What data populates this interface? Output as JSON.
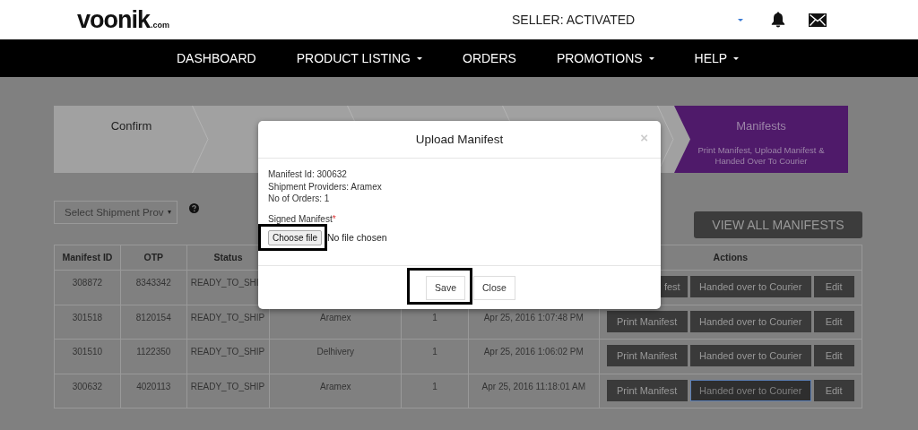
{
  "header": {
    "logo": "voonik",
    "logo_suffix": ".com",
    "seller_status": "SELLER: ACTIVATED"
  },
  "nav": [
    {
      "label": "DASHBOARD",
      "dropdown": false
    },
    {
      "label": "PRODUCT LISTING",
      "dropdown": true
    },
    {
      "label": "ORDERS",
      "dropdown": false
    },
    {
      "label": "PROMOTIONS",
      "dropdown": true
    },
    {
      "label": "HELP",
      "dropdown": true
    }
  ],
  "steps": [
    {
      "label": "Confirm",
      "selected": false
    },
    {
      "selected": false
    },
    {
      "selected": false
    },
    {
      "selected": false
    },
    {
      "label": "Manifests",
      "subtitle": "Print Manifest, Upload Manifest & Handed Over To Courier",
      "selected": true
    }
  ],
  "filter": {
    "placeholder": "Select Shipment Prov"
  },
  "view_all_button": "VIEW ALL MANIFESTS",
  "table": {
    "columns": [
      {
        "label": "Manifest ID"
      },
      {
        "label": "OTP"
      },
      {
        "label": "Status"
      },
      {},
      {},
      {},
      {
        "label": "Actions"
      }
    ],
    "rows": [
      {
        "id": "308872",
        "otp": "8343342",
        "status": "READY_TO_SHI",
        "actions": [
          {
            "label": "fest",
            "focused": false
          },
          {
            "label": "Handed over to Courier",
            "focused": false
          },
          {
            "label": "Edit",
            "focused": false
          }
        ]
      },
      {
        "id": "301518",
        "otp": "8120154",
        "status": "READY_TO_SHIP",
        "provider": "Aramex",
        "orders": "1",
        "date": "Apr 25, 2016 1:07:48 PM",
        "actions": [
          {
            "label": "Print Manifest",
            "focused": false
          },
          {
            "label": "Handed over to Courier",
            "focused": false
          },
          {
            "label": "Edit",
            "focused": false
          }
        ]
      },
      {
        "id": "301510",
        "otp": "1122350",
        "status": "READY_TO_SHIP",
        "provider": "Delhivery",
        "orders": "1",
        "date": "Apr 25, 2016 1:06:02 PM",
        "actions": [
          {
            "label": "Print Manifest",
            "focused": false
          },
          {
            "label": "Handed over to Courier",
            "focused": false
          },
          {
            "label": "Edit",
            "focused": false
          }
        ]
      },
      {
        "id": "300632",
        "otp": "4020113",
        "status": "READY_TO_SHIP",
        "provider": "Aramex",
        "orders": "1",
        "date": "Apr 25, 2016 11:18:01 AM",
        "actions": [
          {
            "label": "Print Manifest",
            "focused": false
          },
          {
            "label": "Handed over to Courier",
            "focused": true
          },
          {
            "label": "Edit",
            "focused": false
          }
        ]
      }
    ]
  },
  "modal": {
    "title": "Upload Manifest",
    "close": "×",
    "details": [
      "Manifest Id: 300632",
      "Shipment Providers: Aramex",
      "No of Orders: 1"
    ],
    "file_label": "Signed Manifest",
    "required_mark": "*",
    "choose_button": "Choose file",
    "file_status": "No file chosen",
    "save_button": "Save",
    "close_button": "Close",
    "highlight_choose": true,
    "highlight_save": true
  }
}
